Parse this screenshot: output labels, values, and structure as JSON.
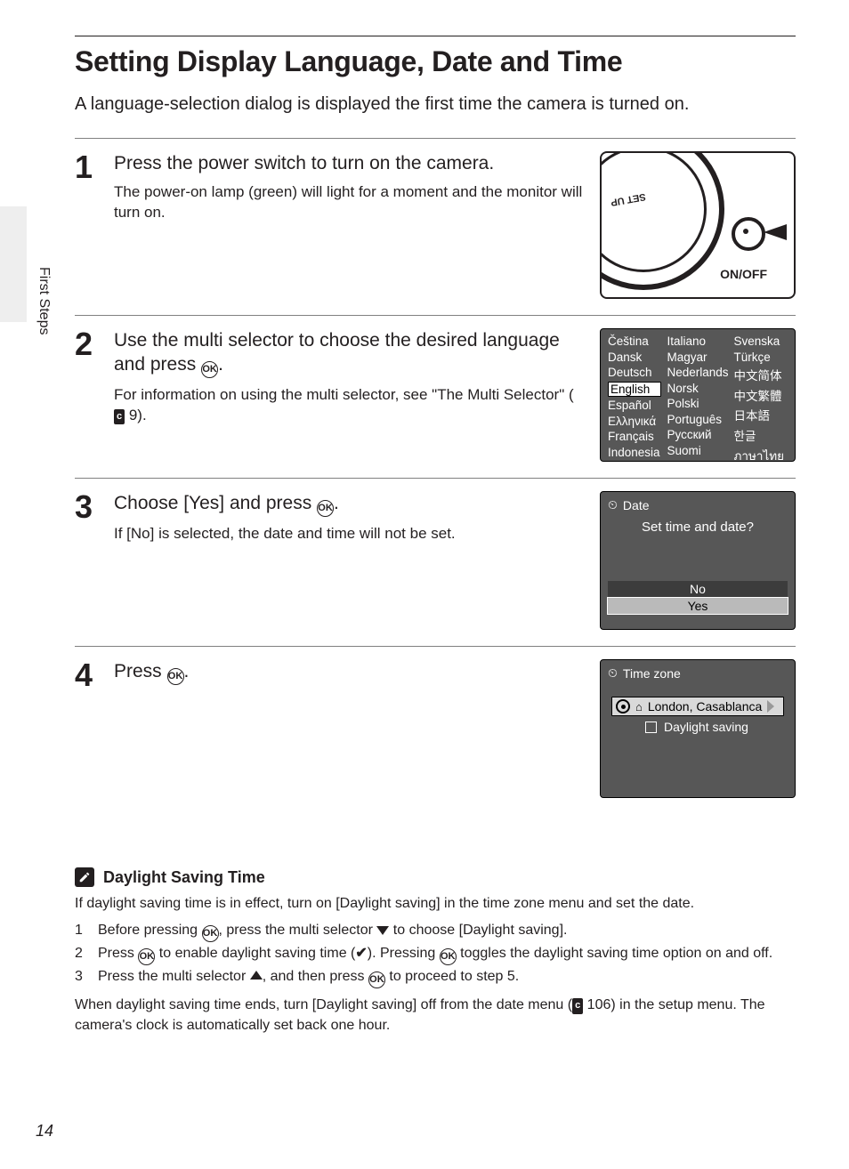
{
  "section_tab": "First Steps",
  "page_number": "14",
  "title": "Setting Display Language, Date and Time",
  "intro": "A language-selection dialog is displayed the first time the camera is turned on.",
  "ok_label": "OK",
  "ref_icon": "c",
  "steps": {
    "1": {
      "num": "1",
      "lead": "Press the power switch to turn on the camera.",
      "desc": "The power-on lamp (green) will light for a moment and the monitor will turn on.",
      "camera": {
        "dial_text": "SET UP",
        "onoff": "ON/OFF"
      }
    },
    "2": {
      "num": "2",
      "lead_a": "Use the multi selector to choose the desired language and press ",
      "lead_b": ".",
      "desc_a": "For information on using the multi selector, see \"The Multi Selector\" (",
      "desc_ref": " 9).",
      "menu": {
        "col1": [
          "Čeština",
          "Dansk",
          "Deutsch",
          "English",
          "Español",
          "Ελληνικά",
          "Français",
          "Indonesia"
        ],
        "col2": [
          "Italiano",
          "Magyar",
          "Nederlands",
          "Norsk",
          "Polski",
          "Português",
          "Русский",
          "Suomi"
        ],
        "col3": [
          "Svenska",
          "Türkçe",
          "中文简体",
          "中文繁體",
          "日本語",
          "한글",
          "ภาษาไทย"
        ],
        "selected": "English"
      }
    },
    "3": {
      "num": "3",
      "lead_a": "Choose [Yes] and press ",
      "lead_b": ".",
      "desc": "If [No] is selected, the date and time will not be set.",
      "dialog": {
        "title": "Date",
        "question": "Set time and date?",
        "no": "No",
        "yes": "Yes"
      }
    },
    "4": {
      "num": "4",
      "lead_a": "Press ",
      "lead_b": ".",
      "dialog": {
        "title": "Time zone",
        "zone": "London, Casablanca",
        "ds": "Daylight saving"
      }
    }
  },
  "note": {
    "title": "Daylight Saving Time",
    "p1": "If daylight saving time is in effect, turn on [Daylight saving] in the time zone menu and set the date.",
    "items": {
      "1": {
        "n": "1",
        "a": "Before pressing ",
        "b": ", press the multi selector ",
        "c": " to choose [Daylight saving]."
      },
      "2": {
        "n": "2",
        "a": "Press ",
        "b": " to enable daylight saving time (",
        "c": "). Pressing ",
        "d": " toggles the daylight saving time option on and off."
      },
      "3": {
        "n": "3",
        "a": "Press the multi selector ",
        "b": ", and then press ",
        "c": " to proceed to step 5."
      }
    },
    "p2_a": "When daylight saving time ends, turn [Daylight saving] off from the date menu (",
    "p2_ref": " 106) in the setup menu. The camera's clock is automatically set back one hour."
  }
}
